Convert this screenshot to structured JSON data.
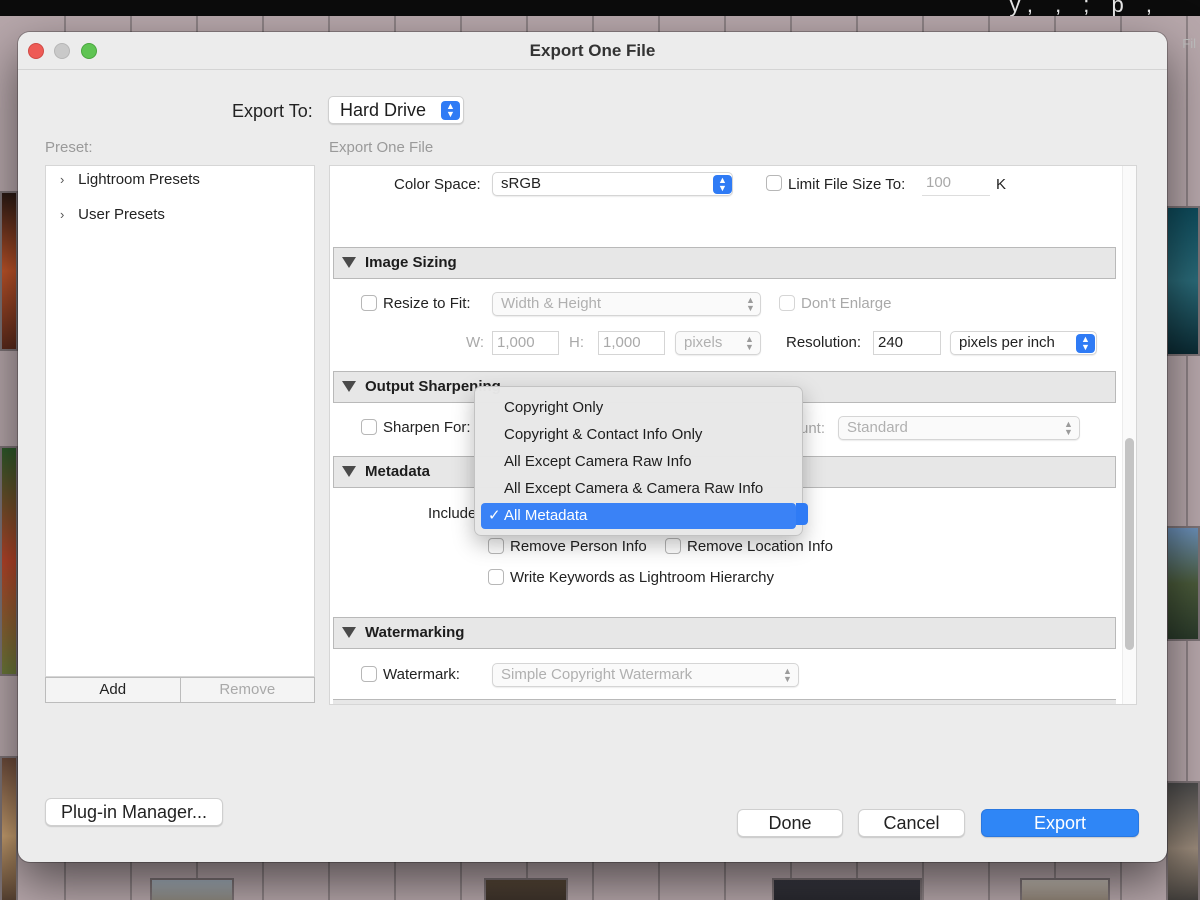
{
  "backdrop": {
    "topbar_fragment": "y, , ; p ,",
    "side_label": "Fil"
  },
  "window": {
    "title": "Export One File"
  },
  "export_to": {
    "label": "Export To:",
    "value": "Hard Drive"
  },
  "presets": {
    "label": "Preset:",
    "items": [
      {
        "label": "Lightroom Presets"
      },
      {
        "label": "User Presets"
      }
    ],
    "add_label": "Add",
    "remove_label": "Remove"
  },
  "settings": {
    "header": "Export One File",
    "color_space": {
      "label": "Color Space:",
      "value": "sRGB"
    },
    "limit_file_size": {
      "label": "Limit File Size To:",
      "value": "100",
      "unit": "K"
    },
    "image_sizing": {
      "title": "Image Sizing",
      "resize_label": "Resize to Fit:",
      "resize_mode": "Width & Height",
      "dont_enlarge": "Don't Enlarge",
      "w_label": "W:",
      "w_value": "1,000",
      "h_label": "H:",
      "h_value": "1,000",
      "units": "pixels",
      "resolution_label": "Resolution:",
      "resolution_value": "240",
      "resolution_units": "pixels per inch"
    },
    "output_sharpening": {
      "title": "Output Sharpening",
      "sharpen_for_label": "Sharpen For:",
      "amount_fragment": "unt:",
      "amount_value": "Standard"
    },
    "metadata": {
      "title": "Metadata",
      "include_label": "Include",
      "remove_person": "Remove Person Info",
      "remove_location": "Remove Location Info",
      "write_keywords": "Write Keywords as Lightroom Hierarchy"
    },
    "watermarking": {
      "title": "Watermarking",
      "watermark_label": "Watermark:",
      "watermark_value": "Simple Copyright Watermark"
    }
  },
  "metadata_menu": {
    "items": [
      {
        "label": "Copyright Only"
      },
      {
        "label": "Copyright & Contact Info Only"
      },
      {
        "label": "All Except Camera Raw Info"
      },
      {
        "label": "All Except Camera & Camera Raw Info"
      },
      {
        "label": "All Metadata",
        "check": "✓"
      }
    ]
  },
  "footer": {
    "plugin_manager": "Plug-in Manager...",
    "done": "Done",
    "cancel": "Cancel",
    "export": "Export"
  },
  "colors": {
    "accent": "#2f86f6",
    "menu_highlight": "#3a82f6",
    "close": "#ee5b56",
    "maximize": "#5fc453"
  }
}
